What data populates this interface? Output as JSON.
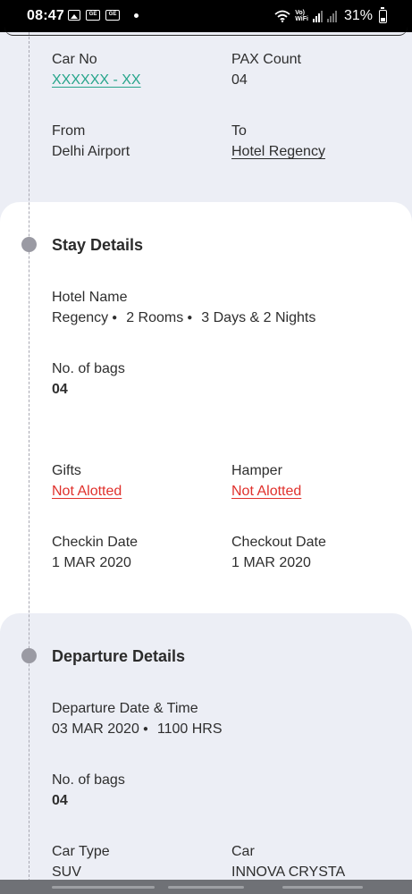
{
  "status_bar": {
    "time": "08:47",
    "battery": "31%",
    "network_label": "VoLTE WiFi",
    "box2_text": "GE",
    "box3_text": "GE"
  },
  "car_section": {
    "car_no_label": "Car No",
    "car_no_value": "XXXXXX - XX",
    "pax_label": "PAX Count",
    "pax_value": "04",
    "from_label": "From",
    "from_value": "Delhi Airport",
    "to_label": "To",
    "to_value": "Hotel Regency"
  },
  "stay": {
    "title": "Stay Details",
    "hotel_label": "Hotel Name",
    "hotel_name": "Regency",
    "rooms": "2 Rooms",
    "duration": "3 Days & 2 Nights",
    "bags_label": "No. of bags",
    "bags_value": "04",
    "gifts_label": "Gifts",
    "gifts_value": "Not Alotted",
    "hamper_label": "Hamper",
    "hamper_value": "Not Alotted",
    "checkin_label": "Checkin Date",
    "checkin_value": "1 MAR 2020",
    "checkout_label": "Checkout Date",
    "checkout_value": "1 MAR 2020"
  },
  "departure": {
    "title": "Departure Details",
    "datetime_label": "Departure Date & Time",
    "date": "03 MAR 2020",
    "time": "1100 HRS",
    "bags_label": "No. of bags",
    "bags_value": "04",
    "car_type_label": "Car Type",
    "car_type_value": "SUV",
    "car_label": "Car",
    "car_value": "INNOVA CRYSTA"
  },
  "colors": {
    "accent_green": "#27a58b",
    "alert_red": "#e0302b",
    "timeline_dot": "#9a9aa3",
    "panel_bg": "#eceef5"
  },
  "icons": [
    "image-icon",
    "notification-icon",
    "wifi-icon",
    "signal-icon",
    "battery-icon"
  ]
}
